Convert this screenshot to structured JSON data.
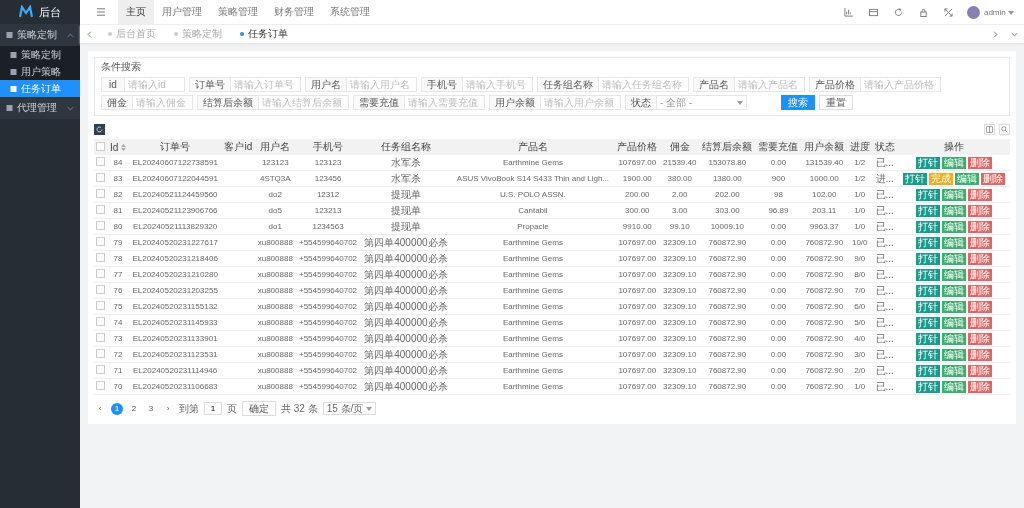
{
  "brand": {
    "title": "后台"
  },
  "sidebar": {
    "items": [
      {
        "label": "策略定制",
        "expanded": true,
        "selected": false,
        "children": [
          {
            "label": "策略定制",
            "selected": false
          },
          {
            "label": "用户策略",
            "selected": false
          },
          {
            "label": "任务订单",
            "selected": true
          }
        ]
      },
      {
        "label": "代理管理",
        "expanded": false,
        "selected": false
      }
    ]
  },
  "top_nav": [
    {
      "label": "主页",
      "selected": true
    },
    {
      "label": "用户管理",
      "selected": false
    },
    {
      "label": "策略管理",
      "selected": false
    },
    {
      "label": "财务管理",
      "selected": false
    },
    {
      "label": "系统管理",
      "selected": false
    }
  ],
  "user": {
    "name": "admin"
  },
  "page_tabs": [
    {
      "label": "后台首页",
      "selected": false
    },
    {
      "label": "策略定制",
      "selected": false
    },
    {
      "label": "任务订单",
      "selected": true
    }
  ],
  "search": {
    "title": "条件搜索",
    "rows": [
      [
        {
          "label": "id",
          "kind": "input",
          "placeholder": "请输入id"
        },
        {
          "label": "订单号",
          "kind": "input",
          "placeholder": "请输入订单号"
        },
        {
          "label": "用户名",
          "kind": "input",
          "placeholder": "请输入用户名"
        },
        {
          "label": "手机号",
          "kind": "input",
          "placeholder": "请输入手机号"
        },
        {
          "label": "任务组名称",
          "kind": "input",
          "placeholder": "请输入任务组名称"
        },
        {
          "label": "产品名",
          "kind": "input",
          "placeholder": "请输入产品名"
        },
        {
          "label": "产品价格",
          "kind": "input",
          "placeholder": "请输入产品价格"
        }
      ],
      [
        {
          "label": "佣金",
          "kind": "input",
          "placeholder": "请输入佣金"
        },
        {
          "label": "结算后余额",
          "kind": "input",
          "placeholder": "请输入结算后余额"
        },
        {
          "label": "需要充值",
          "kind": "input",
          "placeholder": "请输入需要充值"
        },
        {
          "label": "用户余额",
          "kind": "input",
          "placeholder": "请输入用户余额"
        },
        {
          "label": "状态",
          "kind": "select",
          "value": "- 全部 -"
        }
      ]
    ],
    "buttons": [
      {
        "label": "搜索",
        "kind": "primary"
      },
      {
        "label": "重置",
        "kind": "default"
      }
    ]
  },
  "table": {
    "select_all_checked": false,
    "columns": [
      "Id",
      "订单号",
      "客户id",
      "用户名",
      "手机号",
      "任务组名称",
      "产品名",
      "产品价格",
      "佣金",
      "结算后余额",
      "需要充值",
      "用户余额",
      "进度",
      "状态",
      "操作"
    ],
    "rows": [
      {
        "checked": false,
        "cells": [
          "84",
          "EL20240607122738591",
          "",
          "123123",
          "123123",
          "水军杀",
          "Earthmine Gems",
          "107697.00",
          "21539.40",
          "153078.80",
          "0.00",
          "131539.40",
          "1/2",
          "已..."
        ],
        "actions": [
          {
            "label": "打针",
            "kind": "inject"
          },
          {
            "label": "编辑",
            "kind": "edit"
          },
          {
            "label": "删除",
            "kind": "delete"
          }
        ]
      },
      {
        "checked": false,
        "cells": [
          "83",
          "EL20240607122044591",
          "",
          "4STQ3A",
          "123456",
          "水军杀",
          "ASUS VivoBook S14 S433 Thin and Ligh...",
          "1900.00",
          "380.00",
          "1380.00",
          "900",
          "1000.00",
          "1/2",
          "进..."
        ],
        "actions": [
          {
            "label": "打针",
            "kind": "inject"
          },
          {
            "label": "完成",
            "kind": "complete"
          },
          {
            "label": "编辑",
            "kind": "edit"
          },
          {
            "label": "删除",
            "kind": "delete"
          }
        ]
      },
      {
        "checked": false,
        "cells": [
          "82",
          "EL20240521124459560",
          "",
          "do2",
          "12312",
          "提现单",
          "U.S. POLO ASSN.",
          "200.00",
          "2.00",
          "202.00",
          "98",
          "102.00",
          "1/0",
          "已..."
        ],
        "actions": [
          {
            "label": "打针",
            "kind": "inject"
          },
          {
            "label": "编辑",
            "kind": "edit"
          },
          {
            "label": "删除",
            "kind": "delete"
          }
        ]
      },
      {
        "checked": false,
        "cells": [
          "81",
          "EL20240521123906766",
          "",
          "do5",
          "123213",
          "提现单",
          "Cantabil",
          "300.00",
          "3.00",
          "303.00",
          "96.89",
          "203.11",
          "1/0",
          "已..."
        ],
        "actions": [
          {
            "label": "打针",
            "kind": "inject"
          },
          {
            "label": "编辑",
            "kind": "edit"
          },
          {
            "label": "删除",
            "kind": "delete"
          }
        ]
      },
      {
        "checked": false,
        "cells": [
          "80",
          "EL20240521113829320",
          "",
          "do1",
          "1234563",
          "提现单",
          "Propacle",
          "9910.00",
          "99.10",
          "10009.10",
          "0.00",
          "9963.37",
          "1/0",
          "已..."
        ],
        "actions": [
          {
            "label": "打针",
            "kind": "inject"
          },
          {
            "label": "编辑",
            "kind": "edit"
          },
          {
            "label": "删除",
            "kind": "delete"
          }
        ]
      },
      {
        "checked": false,
        "cells": [
          "79",
          "EL20240520231227617",
          "",
          "xu800888",
          "+554599640702",
          "第四单400000必杀",
          "Earthmine Gems",
          "107697.00",
          "32309.10",
          "760872.90",
          "0.00",
          "760872.90",
          "10/0",
          "已..."
        ],
        "actions": [
          {
            "label": "打针",
            "kind": "inject"
          },
          {
            "label": "编辑",
            "kind": "edit"
          },
          {
            "label": "删除",
            "kind": "delete"
          }
        ]
      },
      {
        "checked": false,
        "cells": [
          "78",
          "EL20240520231218406",
          "",
          "xu800888",
          "+554599640702",
          "第四单400000必杀",
          "Earthmine Gems",
          "107697.00",
          "32309.10",
          "760872.90",
          "0.00",
          "760872.90",
          "9/0",
          "已..."
        ],
        "actions": [
          {
            "label": "打针",
            "kind": "inject"
          },
          {
            "label": "编辑",
            "kind": "edit"
          },
          {
            "label": "删除",
            "kind": "delete"
          }
        ]
      },
      {
        "checked": false,
        "cells": [
          "77",
          "EL20240520231210280",
          "",
          "xu800888",
          "+554599640702",
          "第四单400000必杀",
          "Earthmine Gems",
          "107697.00",
          "32309.10",
          "760872.90",
          "0.00",
          "760872.90",
          "8/0",
          "已..."
        ],
        "actions": [
          {
            "label": "打针",
            "kind": "inject"
          },
          {
            "label": "编辑",
            "kind": "edit"
          },
          {
            "label": "删除",
            "kind": "delete"
          }
        ]
      },
      {
        "checked": false,
        "cells": [
          "76",
          "EL20240520231203255",
          "",
          "xu800888",
          "+554599640702",
          "第四单400000必杀",
          "Earthmine Gems",
          "107697.00",
          "32309.10",
          "760872.90",
          "0.00",
          "760872.90",
          "7/0",
          "已..."
        ],
        "actions": [
          {
            "label": "打针",
            "kind": "inject"
          },
          {
            "label": "编辑",
            "kind": "edit"
          },
          {
            "label": "删除",
            "kind": "delete"
          }
        ]
      },
      {
        "checked": false,
        "cells": [
          "75",
          "EL20240520231155132",
          "",
          "xu800888",
          "+554599640702",
          "第四单400000必杀",
          "Earthmine Gems",
          "107697.00",
          "32309.10",
          "760872.90",
          "0.00",
          "760872.90",
          "6/0",
          "已..."
        ],
        "actions": [
          {
            "label": "打针",
            "kind": "inject"
          },
          {
            "label": "编辑",
            "kind": "edit"
          },
          {
            "label": "删除",
            "kind": "delete"
          }
        ]
      },
      {
        "checked": false,
        "cells": [
          "74",
          "EL20240520231145933",
          "",
          "xu800888",
          "+554599640702",
          "第四单400000必杀",
          "Earthmine Gems",
          "107697.00",
          "32309.10",
          "760872.90",
          "0.00",
          "760872.90",
          "5/0",
          "已..."
        ],
        "actions": [
          {
            "label": "打针",
            "kind": "inject"
          },
          {
            "label": "编辑",
            "kind": "edit"
          },
          {
            "label": "删除",
            "kind": "delete"
          }
        ]
      },
      {
        "checked": false,
        "cells": [
          "73",
          "EL20240520231133901",
          "",
          "xu800888",
          "+554599640702",
          "第四单400000必杀",
          "Earthmine Gems",
          "107697.00",
          "32309.10",
          "760872.90",
          "0.00",
          "760872.90",
          "4/0",
          "已..."
        ],
        "actions": [
          {
            "label": "打针",
            "kind": "inject"
          },
          {
            "label": "编辑",
            "kind": "edit"
          },
          {
            "label": "删除",
            "kind": "delete"
          }
        ]
      },
      {
        "checked": false,
        "cells": [
          "72",
          "EL20240520231123531",
          "",
          "xu800888",
          "+554599640702",
          "第四单400000必杀",
          "Earthmine Gems",
          "107697.00",
          "32309.10",
          "760872.90",
          "0.00",
          "760872.90",
          "3/0",
          "已..."
        ],
        "actions": [
          {
            "label": "打针",
            "kind": "inject"
          },
          {
            "label": "编辑",
            "kind": "edit"
          },
          {
            "label": "删除",
            "kind": "delete"
          }
        ]
      },
      {
        "checked": false,
        "cells": [
          "71",
          "EL20240520231114946",
          "",
          "xu800888",
          "+554599640702",
          "第四单400000必杀",
          "Earthmine Gems",
          "107697.00",
          "32309.10",
          "760872.90",
          "0.00",
          "760872.90",
          "2/0",
          "已..."
        ],
        "actions": [
          {
            "label": "打针",
            "kind": "inject"
          },
          {
            "label": "编辑",
            "kind": "edit"
          },
          {
            "label": "删除",
            "kind": "delete"
          }
        ]
      },
      {
        "checked": false,
        "cells": [
          "70",
          "EL20240520231106683",
          "",
          "xu800888",
          "+554599640702",
          "第四单400000必杀",
          "Earthmine Gems",
          "107697.00",
          "32309.10",
          "760872.90",
          "0.00",
          "760872.90",
          "1/0",
          "已..."
        ],
        "actions": [
          {
            "label": "打针",
            "kind": "inject"
          },
          {
            "label": "编辑",
            "kind": "edit"
          },
          {
            "label": "删除",
            "kind": "delete"
          }
        ]
      }
    ]
  },
  "pagination": {
    "prev": "‹",
    "pages": [
      {
        "label": "1",
        "selected": true
      },
      {
        "label": "2",
        "selected": false
      },
      {
        "label": "3",
        "selected": false
      }
    ],
    "next": "›",
    "goto_label": "到第",
    "goto_value": "1",
    "page_unit": "页",
    "confirm": "确定",
    "total": "共 32 条",
    "page_size": "15 条/页"
  }
}
